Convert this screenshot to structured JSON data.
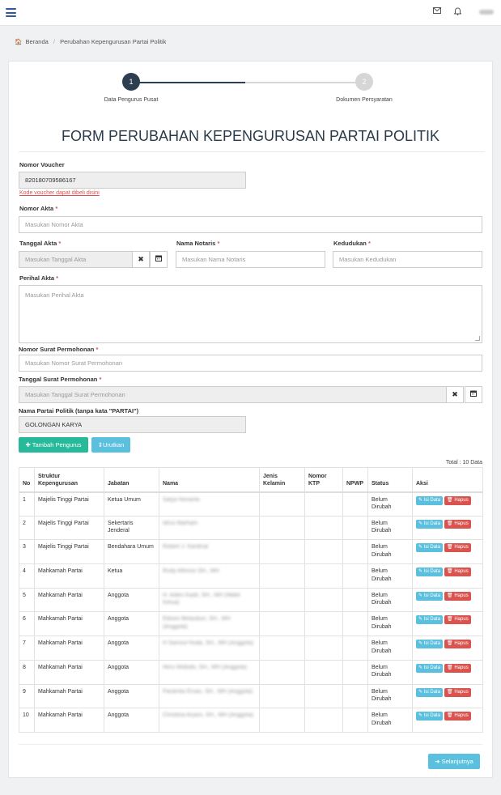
{
  "topbar": {
    "user_label": "test"
  },
  "breadcrumb": {
    "home": "Beranda",
    "current": "Perubahan Kepengurusan Partai Politik"
  },
  "steps": [
    {
      "number": "1",
      "label": "Data Pengurus Pusat"
    },
    {
      "number": "2",
      "label": "Dokumen Persyaratan"
    }
  ],
  "form": {
    "title": "FORM PERUBAHAN KEPENGURUSAN PARTAI POLITIK",
    "required_mark": "*",
    "voucher": {
      "label": "Nomor Voucher",
      "value": "820180709586167",
      "link": "Kode voucher dapat dibeli disini"
    },
    "akta": {
      "label": "Nomor Akta",
      "placeholder": "Masukan Nomor Akta"
    },
    "tanggal_akta": {
      "label": "Tanggal Akta",
      "placeholder": "Masukan Tanggal Akta"
    },
    "notaris": {
      "label": "Nama Notaris",
      "placeholder": "Masukan Nama Notaris"
    },
    "kedudukan": {
      "label": "Kedudukan",
      "placeholder": "Masukan Kedudukan"
    },
    "perihal": {
      "label": "Perihal Akta",
      "placeholder": "Masukan Perihal Akta"
    },
    "surat": {
      "label": "Nomor Surat Permohonan",
      "placeholder": "Masukan Nomor Surat Permohonan"
    },
    "tanggal_surat": {
      "label": "Tanggal Surat Permohonan",
      "placeholder": "Masukan Tanggal Surat Permohonan"
    },
    "partai": {
      "label": "Nama Partai Politik (tanpa kata \"PARTAI\")",
      "value": "GOLONGAN KARYA"
    }
  },
  "buttons": {
    "tambah": "Tambah Pengurus",
    "urutkan": "Urutkan",
    "isi": "Isi Data",
    "hapus": "Hapus",
    "selanjutnya": "Selanjutnya"
  },
  "table": {
    "total": "Total : 10 Data",
    "headers": [
      "No",
      "Struktur Kepengurusan",
      "Jabatan",
      "Nama",
      "Jenis Kelamin",
      "Nomor KTP",
      "NPWP",
      "Status",
      "Aksi"
    ],
    "rows": [
      {
        "no": "1",
        "struktur": "Majelis Tinggi Partai",
        "jabatan": "Ketua Umum",
        "nama": "Satya Novanto",
        "status": "Belum Dirubah"
      },
      {
        "no": "2",
        "struktur": "Majelis Tinggi Partai",
        "jabatan": "Sekertaris Jenderal",
        "nama": "Idrus Marham",
        "status": "Belum Dirubah"
      },
      {
        "no": "3",
        "struktur": "Majelis Tinggi Partai",
        "jabatan": "Bendahara Umum",
        "nama": "Robert J. Kardinal",
        "status": "Belum Dirubah"
      },
      {
        "no": "4",
        "struktur": "Mahkamah Partai",
        "jabatan": "Ketua",
        "nama": "Rudy Alfonso SH., MH",
        "status": "Belum Dirubah"
      },
      {
        "no": "5",
        "struktur": "Mahkamah Partai",
        "jabatan": "Anggota",
        "nama": "H. Adies Kadir, SH., MH (Wakil Ketua)",
        "status": "Belum Dirubah"
      },
      {
        "no": "6",
        "struktur": "Mahkamah Partai",
        "jabatan": "Anggota",
        "nama": "Edison Betaubun, SH., MH (Anggota)",
        "status": "Belum Dirubah"
      },
      {
        "no": "7",
        "struktur": "Mahkamah Partai",
        "jabatan": "Anggota",
        "nama": "H Samsul Huda, SH., MH (Anggota)",
        "status": "Belum Dirubah"
      },
      {
        "no": "8",
        "struktur": "Mahkamah Partai",
        "jabatan": "Anggota",
        "nama": "Heru Widodo, SH., MH (Anggota)",
        "status": "Belum Dirubah"
      },
      {
        "no": "9",
        "struktur": "Mahkamah Partai",
        "jabatan": "Anggota",
        "nama": "Paramita Ersan, SH., MH (Anggota)",
        "status": "Belum Dirubah"
      },
      {
        "no": "10",
        "struktur": "Mahkamah Partai",
        "jabatan": "Anggota",
        "nama": "Christina Aryani, SH., MH (Anggota)",
        "status": "Belum Dirubah"
      }
    ]
  },
  "colors": {
    "primary": "#2c3e50",
    "success": "#26b99a",
    "info": "#5bc0de",
    "danger": "#d9534f"
  }
}
